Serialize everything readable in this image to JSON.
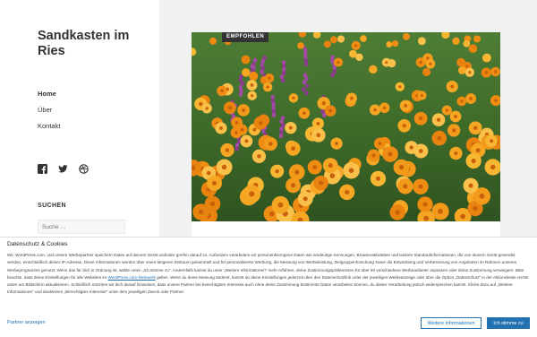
{
  "site": {
    "title": "Sandkasten im Ries"
  },
  "nav": {
    "items": [
      {
        "label": "Home",
        "active": true
      },
      {
        "label": "Über"
      },
      {
        "label": "Kontakt"
      }
    ]
  },
  "social": {
    "icons": [
      "facebook-icon",
      "twitter-icon",
      "dribbble-icon"
    ]
  },
  "widget": {
    "title": "SUCHEN",
    "search_placeholder": "Suche …"
  },
  "post": {
    "badge": "EMPFOHLEN"
  },
  "consent": {
    "title": "Datenschutz & Cookies",
    "text_1": "Wir, WordPress.com, und unsere Werbepartner speichern Daten auf deinem Gerät und/oder greifen darauf zu. Außerdem verarbeiten wir personenbezogene Daten wie eindeutige Kennungen, Browseraktivitäten und weitere Standardinformationen, die von deinem Gerät gesendet werden, einschließlich deiner IP-Adresse. Diese Informationen werden über einen längeren Zeitraum gesammelt und für personalisierte Werbung, die Messung von Werbeleistung, Zielgruppenforschung sowie die Entwicklung und Verbesserung von Angeboten im Rahmen unseres Werbeprogramms genutzt. Wenn das für dich in Ordnung ist, wähle unten „Ich stimme zu\". Andernfalls kannst du unter „Weitere Informationen\" mehr erfahren, deine Zustimmungspräferenzen für über 50 verschiedene Werbeanbieter anpassen oder deine Zustimmung verweigern. Bitte beachte, dass deine Einstellungen für alle Websites im ",
    "link": "WordPress.com-Netzwerk",
    "text_2": " gelten. Wenn du deine Meinung änderst, kannst du deine Einstellungen jederzeit über den Datenschutzlink unter der jeweiligen Werbeanzeige oder über die Option „Datenschutz\" in der Aktionsleiste rechts unten am Bildschirm aktualisieren. Schließlich möchten wir dich darauf hinweisen, dass unsere Partner bei berechtigtem Interesse auch ohne deine Zustimmung bestimmte Daten verarbeiten können, du dieser Verarbeitung jedoch widersprechen kannst. Klicke dazu auf „Weitere Informationen\" und deaktiviere „Berechtigtes Interesse\" unter dem jeweiligen Zweck oder Partner.",
    "partner_link": "Partner anzeigen",
    "btn_more": "Weitere Informationen",
    "btn_accept": "Ich stimme zu"
  }
}
